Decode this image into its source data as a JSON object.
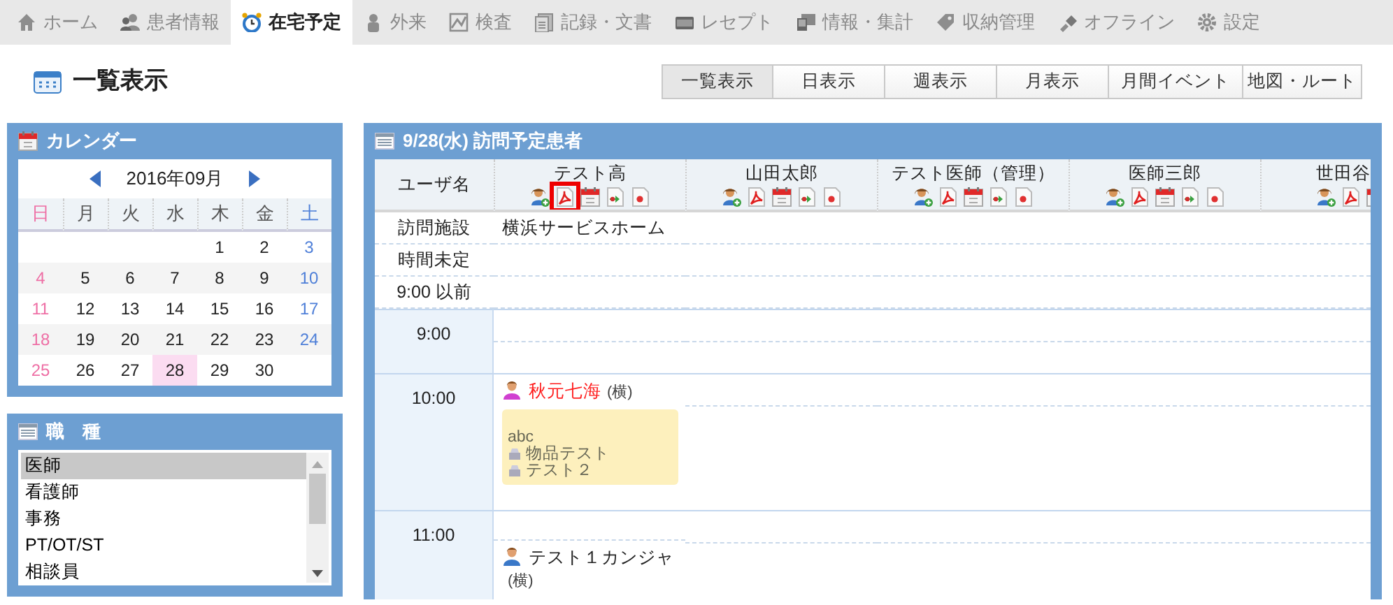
{
  "nav_tabs": [
    {
      "label": "ホーム",
      "selected": false
    },
    {
      "label": "患者情報",
      "selected": false
    },
    {
      "label": "在宅予定",
      "selected": true
    },
    {
      "label": "外来",
      "selected": false
    },
    {
      "label": "検査",
      "selected": false
    },
    {
      "label": "記録・文書",
      "selected": false
    },
    {
      "label": "レセプト",
      "selected": false
    },
    {
      "label": "情報・集計",
      "selected": false
    },
    {
      "label": "収納管理",
      "selected": false
    },
    {
      "label": "オフライン",
      "selected": false
    },
    {
      "label": "設定",
      "selected": false
    }
  ],
  "page_title": "一覧表示",
  "view_buttons": [
    {
      "label": "一覧表示",
      "selected": true
    },
    {
      "label": "日表示",
      "selected": false
    },
    {
      "label": "週表示",
      "selected": false
    },
    {
      "label": "月表示",
      "selected": false
    },
    {
      "label": "月間イベント",
      "selected": false
    },
    {
      "label": "地図・ルート",
      "selected": false
    }
  ],
  "calendar": {
    "title": "カレンダー",
    "month": "2016年09月",
    "weekdays": [
      "日",
      "月",
      "火",
      "水",
      "木",
      "金",
      "土"
    ],
    "weeks": [
      [
        {
          "kind": "blank"
        },
        {
          "kind": "blank"
        },
        {
          "kind": "blank"
        },
        {
          "kind": "blank"
        },
        {
          "text": "1",
          "selected": false
        },
        {
          "text": "2",
          "selected": false
        },
        {
          "text": "3",
          "selected": false
        }
      ],
      [
        {
          "text": "4",
          "selected": false
        },
        {
          "text": "5",
          "selected": false
        },
        {
          "text": "6",
          "selected": false
        },
        {
          "text": "7",
          "selected": false
        },
        {
          "text": "8",
          "selected": false
        },
        {
          "text": "9",
          "selected": false
        },
        {
          "text": "10",
          "selected": false
        }
      ],
      [
        {
          "text": "11",
          "selected": false
        },
        {
          "text": "12",
          "selected": false
        },
        {
          "text": "13",
          "selected": false
        },
        {
          "text": "14",
          "selected": false
        },
        {
          "text": "15",
          "selected": false
        },
        {
          "text": "16",
          "selected": false
        },
        {
          "text": "17",
          "selected": false
        }
      ],
      [
        {
          "text": "18",
          "selected": false
        },
        {
          "text": "19",
          "selected": false
        },
        {
          "text": "20",
          "selected": false
        },
        {
          "text": "21",
          "selected": false
        },
        {
          "text": "22",
          "selected": false
        },
        {
          "text": "23",
          "selected": false
        },
        {
          "text": "24",
          "selected": false
        }
      ],
      [
        {
          "text": "25",
          "selected": false
        },
        {
          "text": "26",
          "selected": false
        },
        {
          "text": "27",
          "selected": false
        },
        {
          "text": "28",
          "selected": true
        },
        {
          "text": "29",
          "selected": false
        },
        {
          "text": "30",
          "selected": false
        },
        {
          "kind": "blank"
        }
      ]
    ]
  },
  "job_types": {
    "title": "職　種",
    "items": [
      {
        "label": "医師",
        "selected": true
      },
      {
        "label": "看護師",
        "selected": false
      },
      {
        "label": "事務",
        "selected": false
      },
      {
        "label": "PT/OT/ST",
        "selected": false
      },
      {
        "label": "相談員",
        "selected": false
      }
    ]
  },
  "schedule": {
    "title": "9/28(水) 訪問予定患者",
    "user_header": "ユーザ名",
    "users": [
      {
        "name": "テスト高",
        "icons": [
          {
            "kind": "add-person",
            "highlighted": false
          },
          {
            "kind": "pdf",
            "highlighted": true
          },
          {
            "kind": "calendar",
            "highlighted": false
          },
          {
            "kind": "doc-arrow",
            "highlighted": false
          },
          {
            "kind": "doc-dot",
            "highlighted": false
          }
        ]
      },
      {
        "name": "山田太郎",
        "icons": [
          {
            "kind": "add-person",
            "highlighted": false
          },
          {
            "kind": "pdf",
            "highlighted": false
          },
          {
            "kind": "calendar",
            "highlighted": false
          },
          {
            "kind": "doc-arrow",
            "highlighted": false
          },
          {
            "kind": "doc-dot",
            "highlighted": false
          }
        ]
      },
      {
        "name": "テスト医師（管理）",
        "icons": [
          {
            "kind": "add-person",
            "highlighted": false
          },
          {
            "kind": "pdf",
            "highlighted": false
          },
          {
            "kind": "calendar",
            "highlighted": false
          },
          {
            "kind": "doc-arrow",
            "highlighted": false
          },
          {
            "kind": "doc-dot",
            "highlighted": false
          }
        ]
      },
      {
        "name": "医師三郎",
        "icons": [
          {
            "kind": "add-person",
            "highlighted": false
          },
          {
            "kind": "pdf",
            "highlighted": false
          },
          {
            "kind": "calendar",
            "highlighted": false
          },
          {
            "kind": "doc-arrow",
            "highlighted": false
          },
          {
            "kind": "doc-dot",
            "highlighted": false
          }
        ]
      },
      {
        "name": "世田谷",
        "icons": [
          {
            "kind": "add-person",
            "highlighted": false
          },
          {
            "kind": "pdf",
            "highlighted": false
          },
          {
            "kind": "calendar",
            "highlighted": false
          }
        ]
      }
    ],
    "info_rows": [
      {
        "label": "訪問施設",
        "cells": [
          {
            "text": "横浜サービスホーム"
          }
        ]
      },
      {
        "label": "時間未定"
      },
      {
        "label": "9:00 以前"
      }
    ],
    "hour_rows": [
      {
        "label": "9:00"
      },
      {
        "label": "10:00",
        "cells": [
          {
            "visits": [
              {
                "patient": "秋元七海",
                "kind": "female",
                "color": "#ff2020",
                "facility": "(横)",
                "note_box": true,
                "note": {
                  "text": "abc",
                  "items": [
                    "物品テスト",
                    "テスト２"
                  ]
                }
              }
            ]
          }
        ]
      },
      {
        "label": "11:00",
        "cells": [
          {
            "visits": [
              {
                "patient": "テスト１カンジャ",
                "kind": "male",
                "color": "#222222",
                "facility": "(横)"
              }
            ]
          }
        ]
      }
    ]
  }
}
